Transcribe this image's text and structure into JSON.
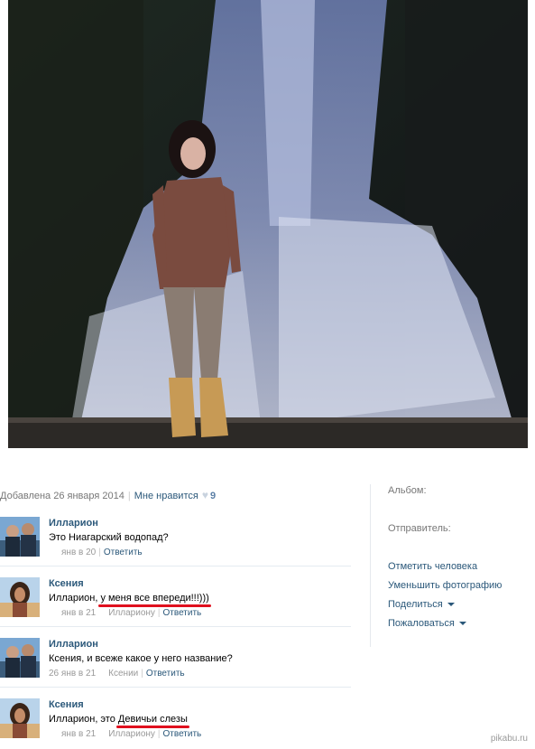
{
  "photo": {
    "alt": ""
  },
  "meta": {
    "added": "Добавлена 26 января 2014",
    "like_label": "Мне нравится",
    "likes": "9"
  },
  "comments": [
    {
      "author": "Илларион",
      "text": "Это Ниагарский водопад?",
      "date": "янв в 20",
      "reply_to": "",
      "reply": "Ответить"
    },
    {
      "author": "Ксения",
      "text_before": "Илларион, ",
      "text_highlight": "у меня все впереди!!!)))",
      "date": "янв в 21",
      "reply_to": "Иллариону",
      "reply": "Ответить"
    },
    {
      "author": "Илларион",
      "text": "Ксения, и всеже какое у него название?",
      "date": "26 янв в 21",
      "reply_to": "Ксении",
      "reply": "Ответить"
    },
    {
      "author": "Ксения",
      "text_before": "Илларион, это ",
      "text_highlight": "Девичьи слезы",
      "date": "янв в 21",
      "reply_to": "Иллариону",
      "reply": "Ответить"
    }
  ],
  "sidebar": {
    "album_label": "Альбом:",
    "sender_label": "Отправитель:",
    "actions": [
      "Отметить человека",
      "Уменьшить фотографию",
      "Поделиться",
      "Пожаловаться"
    ]
  },
  "watermark": "pikabu.ru",
  "colors": {
    "link": "#2b587a",
    "highlight": "#e0101e",
    "muted": "#999999"
  }
}
